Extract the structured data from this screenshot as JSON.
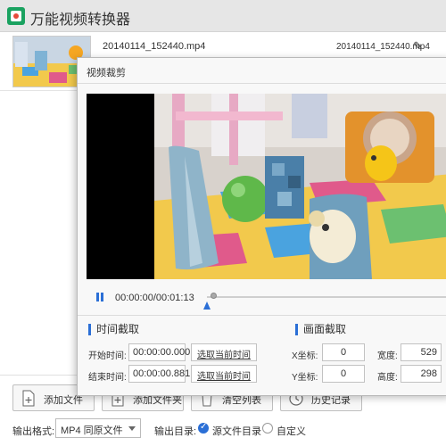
{
  "app": {
    "title": "万能视频转换器"
  },
  "file": {
    "name": "20140114_152440.mp4",
    "output_name": "20140114_152440.mp4",
    "edit_icon": "pencil-icon"
  },
  "dialog": {
    "title": "视频裁剪",
    "player": {
      "time": "00:00:00/00:01:13",
      "progress": 0.0
    },
    "time_section": {
      "title": "时间截取",
      "start_label": "开始时间:",
      "start_value": "00:00:00.000",
      "end_label": "结束时间:",
      "end_value": "00:00:00.881",
      "set_start_label": "选取当前时间",
      "set_end_label": "选取当前时间"
    },
    "crop_section": {
      "title": "画面截取",
      "x_label": "X坐标:",
      "x_value": "0",
      "y_label": "Y坐标:",
      "y_value": "0",
      "width_label": "宽度:",
      "width_value": "529",
      "height_label": "高度:",
      "height_value": "298"
    }
  },
  "toolbar": {
    "add_file": "添加文件",
    "add_folder": "添加文件夹",
    "clear_list": "清空列表",
    "history": "历史记录"
  },
  "output": {
    "format_label": "输出格式:",
    "format_value": "MP4 同原文件",
    "dir_label": "输出目录:",
    "dir_option_source": "源文件目录",
    "dir_option_custom": "自定义",
    "selected": "源文件目录"
  },
  "colors": {
    "accent": "#2b6fd6",
    "brand": "#1aa260"
  }
}
